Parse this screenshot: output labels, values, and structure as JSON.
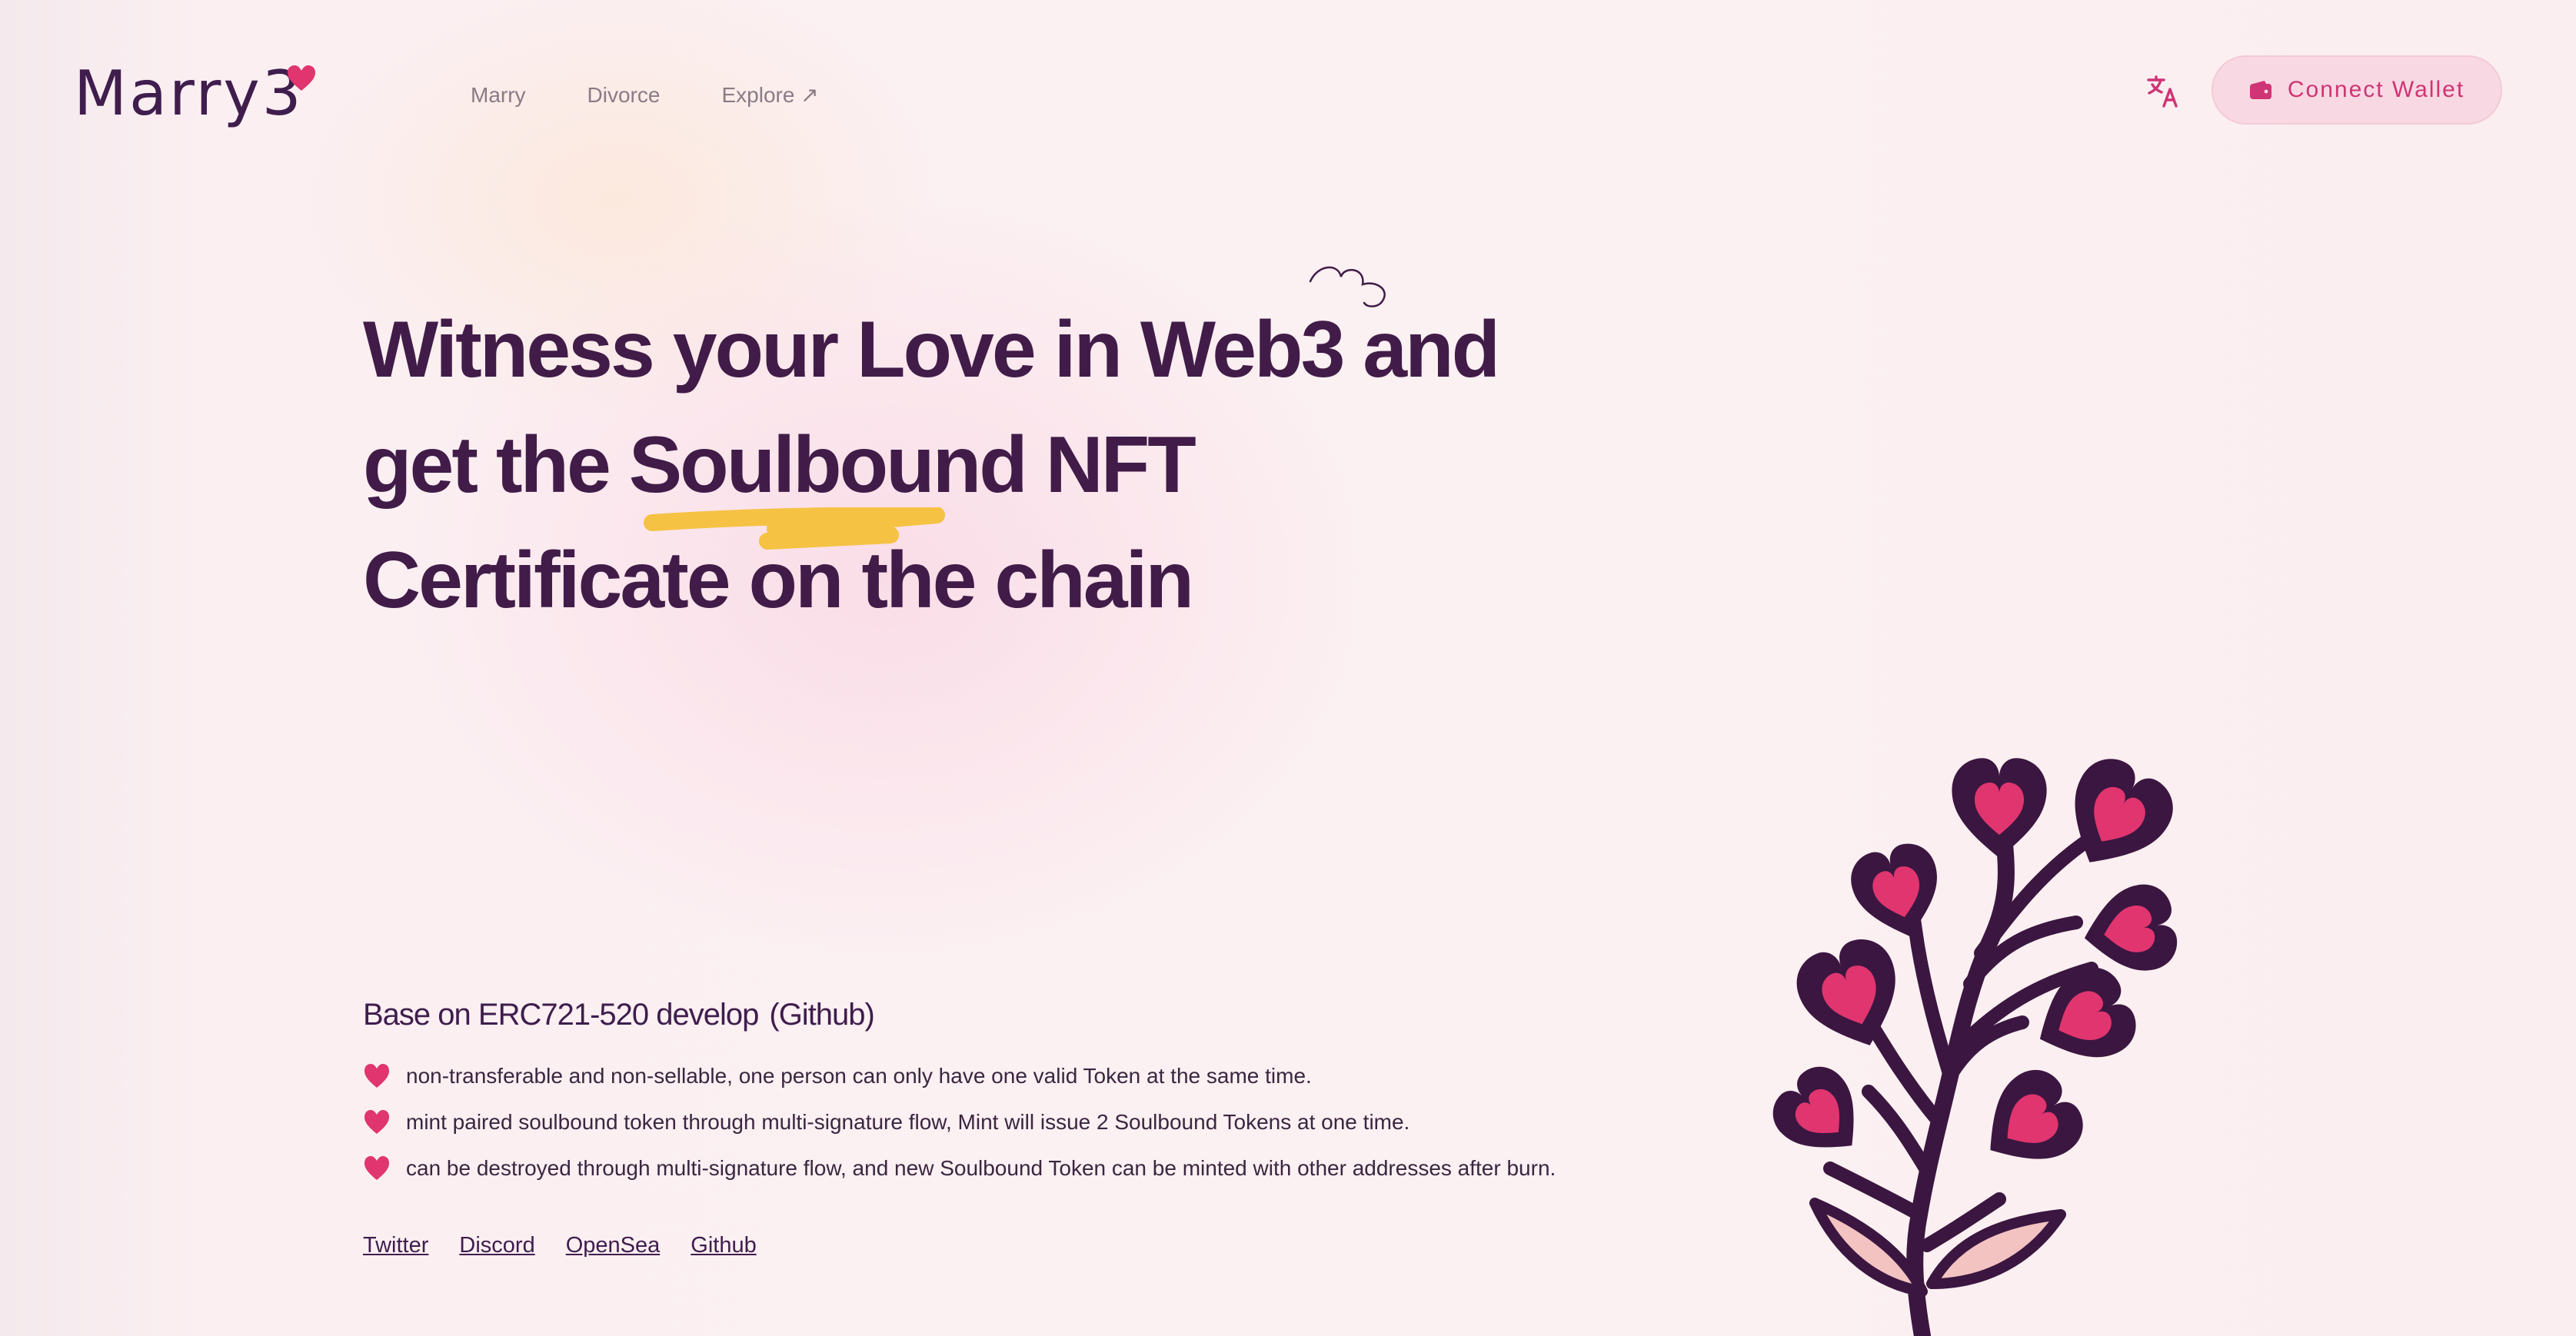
{
  "colors": {
    "accent": "#e0356f",
    "dark_purple": "#411c48",
    "highlight": "#f5c243",
    "button_bg": "#f8d9e3"
  },
  "header": {
    "logo_text": "Marry3",
    "nav": [
      {
        "label": "Marry"
      },
      {
        "label": "Divorce"
      },
      {
        "label": "Explore ↗"
      }
    ],
    "translate_icon": "translate-icon",
    "wallet_button": {
      "icon": "wallet-icon",
      "label": "Connect Wallet"
    }
  },
  "hero": {
    "line1": "Witness your Love in Web3 and",
    "line2_prefix": "get the ",
    "line2_highlight": "Soulbound",
    "line2_suffix": " NFT",
    "line3": "Certificate on the chain"
  },
  "features": {
    "title": "Base on ERC721-520 develop",
    "github_label": "(Github)",
    "items": [
      "non-transferable and non-sellable, one person can only have one valid Token at the same time.",
      "mint paired soulbound token through multi-signature flow, Mint will issue 2 Soulbound Tokens at one time.",
      "can be destroyed through multi-signature flow, and new Soulbound Token can be minted with other addresses after burn."
    ]
  },
  "links": [
    "Twitter",
    "Discord",
    "OpenSea",
    "Github"
  ]
}
